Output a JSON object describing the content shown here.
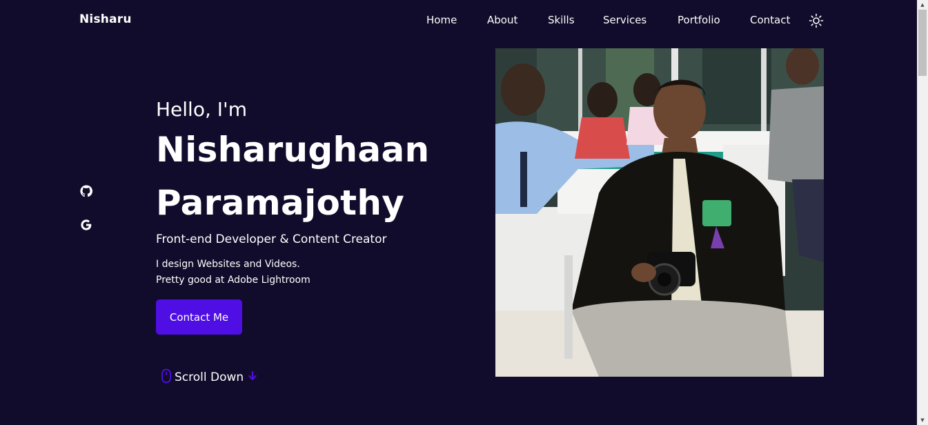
{
  "header": {
    "logo": "Nisharu",
    "nav": [
      {
        "label": "Home"
      },
      {
        "label": "About"
      },
      {
        "label": "Skills"
      },
      {
        "label": "Services"
      },
      {
        "label": "Portfolio"
      },
      {
        "label": "Contact"
      }
    ],
    "theme_icon": "sun-icon"
  },
  "social": {
    "icons": [
      "github-icon",
      "google-icon"
    ]
  },
  "hero": {
    "greeting": "Hello, I'm",
    "name_first": "Nisharughaan",
    "name_last": "Paramajothy",
    "role": "Front-end Developer & Content Creator",
    "desc_line1": "I design Websites and Videos.",
    "desc_line2": "Pretty good at Adobe Lightroom",
    "cta_label": "Contact Me",
    "scroll_label": "Scroll Down",
    "scroll_icons": [
      "mouse-icon",
      "arrow-down-icon"
    ]
  },
  "colors": {
    "background": "#110c2b",
    "accent": "#4f0ee3",
    "text": "#ffffff"
  }
}
